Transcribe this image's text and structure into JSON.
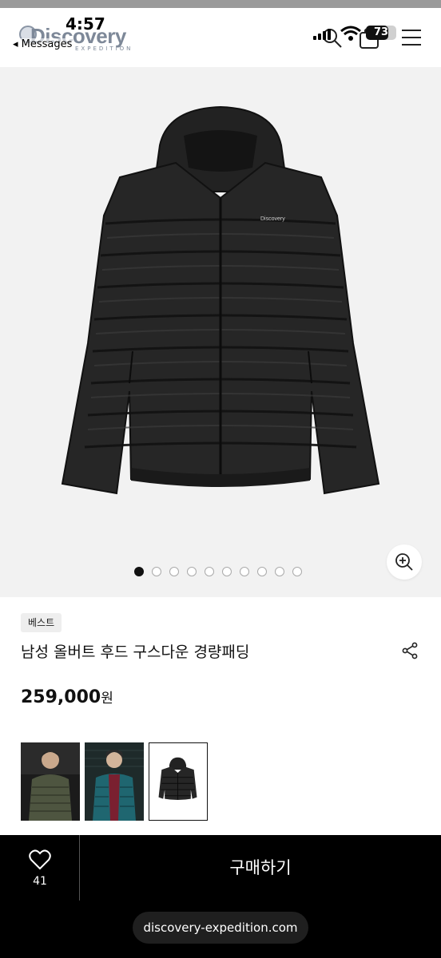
{
  "status": {
    "time": "4:57",
    "back_app": "◂ Messages",
    "battery": "73",
    "battery_level": 0.73
  },
  "header": {
    "logo_text": "Discovery",
    "logo_sub": "EXPEDITION",
    "icons": [
      "search-icon",
      "shopping-bag-icon",
      "menu-icon"
    ]
  },
  "gallery": {
    "jacket_logo": "Discovery",
    "image_count": 10,
    "active_index": 0,
    "zoom_icon": "zoom-in-icon"
  },
  "product": {
    "badge": "베스트",
    "title": "남성 올버트 후드 구스다운 경량패딩",
    "price": "259,000",
    "price_unit": "원"
  },
  "colors": {
    "swatches": [
      "khaki",
      "teal",
      "black"
    ],
    "selected_index": 2
  },
  "bottom": {
    "like_count": "41",
    "buy_label": "구매하기",
    "url": "discovery-expedition.com"
  }
}
